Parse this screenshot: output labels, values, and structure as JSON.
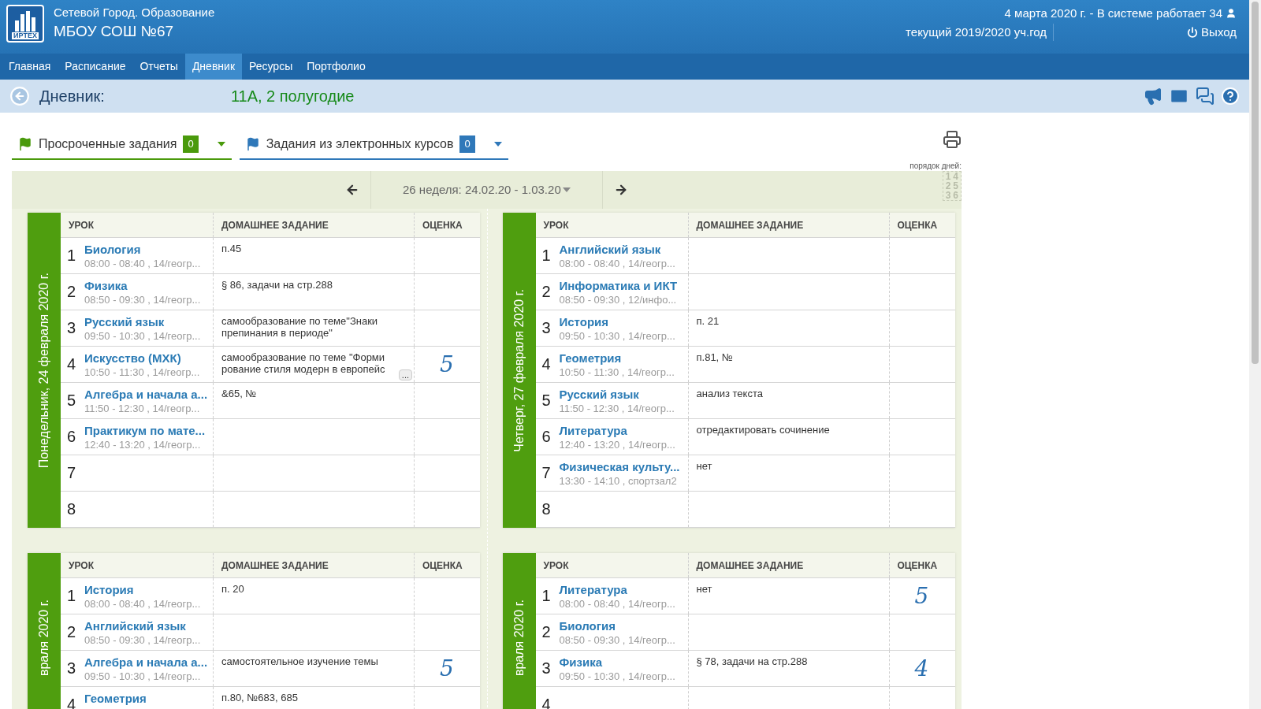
{
  "header": {
    "logo_text": "ИРТЕХ",
    "system": "Сетевой Город. Образование",
    "school": "МБОУ СОШ №67",
    "status": "4 марта 2020 г. - В системе работает 34",
    "year": "текущий 2019/2020 уч.год",
    "logout": "Выход"
  },
  "nav": [
    {
      "label": "Главная",
      "selected": false
    },
    {
      "label": "Расписание",
      "selected": false
    },
    {
      "label": "Отчеты",
      "selected": false
    },
    {
      "label": "Дневник",
      "selected": true
    },
    {
      "label": "Ресурсы",
      "selected": false
    },
    {
      "label": "Портфолио",
      "selected": false
    }
  ],
  "page_title": {
    "label": "Дневник:",
    "class_name": "11А, 2 полугодие"
  },
  "filters": [
    {
      "label": "Просроченные задания",
      "count": "0",
      "color": "#4a9a0c"
    },
    {
      "label": "Задания из электронных курсов",
      "count": "0",
      "color": "#2f78b9"
    }
  ],
  "day_order": {
    "label": "порядок дней:",
    "digits": [
      "1",
      "4",
      "2",
      "5",
      "3",
      "6"
    ]
  },
  "week": {
    "label": "26 неделя: 24.02.20 - 1.03.20"
  },
  "days": [
    {
      "title": "Понедельник, 24 февраля 2020 г.",
      "columns": [
        "УРОК",
        "ДОМАШНЕЕ ЗАДАНИЕ",
        "ОЦЕНКА"
      ],
      "lessons": [
        {
          "number": "1",
          "subject": "Биология",
          "time": "08:00 - 08:40 , 14/геогр...",
          "homework": "п.45"
        },
        {
          "number": "2",
          "subject": "Физика",
          "time": "08:50 - 09:30 , 14/геогр...",
          "homework": "§ 86, задачи на стр.288"
        },
        {
          "number": "3",
          "subject": "Русский язык",
          "time": "09:50 - 10:30 , 14/геогр...",
          "homework": "самообразование по теме\"Знаки препинания в периоде\""
        },
        {
          "number": "4",
          "subject": "Искусство (МХК)",
          "time": "10:50 - 11:30 , 14/геогр...",
          "homework": "самообразование по теме \"Форми рование стиля модерн в европейс",
          "more": "...",
          "grade": "5"
        },
        {
          "number": "5",
          "subject": "Алгебра и начала а...",
          "time": "11:50 - 12:30 , 14/геогр...",
          "homework": "&65, №"
        },
        {
          "number": "6",
          "subject": "Практикум по мате...",
          "time": "12:40 - 13:20 , 14/геогр..."
        },
        {
          "number": "7"
        },
        {
          "number": "8"
        }
      ]
    },
    {
      "title": "Четверг, 27 февраля 2020 г.",
      "columns": [
        "УРОК",
        "ДОМАШНЕЕ ЗАДАНИЕ",
        "ОЦЕНКА"
      ],
      "lessons": [
        {
          "number": "1",
          "subject": "Английский язык",
          "time": "08:00 - 08:40 , 14/геогр..."
        },
        {
          "number": "2",
          "subject": "Информатика и ИКТ",
          "time": "08:50 - 09:30 , 12/инфо..."
        },
        {
          "number": "3",
          "subject": "История",
          "time": "09:50 - 10:30 , 14/геогр...",
          "homework": "п. 21"
        },
        {
          "number": "4",
          "subject": "Геометрия",
          "time": "10:50 - 11:30 , 14/геогр...",
          "homework": "п.81, №"
        },
        {
          "number": "5",
          "subject": "Русский язык",
          "time": "11:50 - 12:30 , 14/геогр...",
          "homework": "анализ текста"
        },
        {
          "number": "6",
          "subject": "Литература",
          "time": "12:40 - 13:20 , 14/геогр...",
          "homework": "отредактировать сочинение"
        },
        {
          "number": "7",
          "subject": "Физическая культу...",
          "time": "13:30 - 14:10 , спортзал2",
          "homework": "нет"
        },
        {
          "number": "8"
        }
      ]
    },
    {
      "title": "враля 2020 г.",
      "columns": [
        "УРОК",
        "ДОМАШНЕЕ ЗАДАНИЕ",
        "ОЦЕНКА"
      ],
      "lessons": [
        {
          "number": "1",
          "subject": "История",
          "time": "08:00 - 08:40 , 14/геогр...",
          "homework": "п. 20"
        },
        {
          "number": "2",
          "subject": "Английский язык",
          "time": "08:50 - 09:30 , 14/геогр..."
        },
        {
          "number": "3",
          "subject": "Алгебра и начала а...",
          "time": "09:50 - 10:30 , 14/геогр...",
          "homework": "самостоятельное изучение темы",
          "grade": "5"
        },
        {
          "number": "4",
          "subject": "Геометрия",
          "homework": "п.80, №683, 685"
        }
      ]
    },
    {
      "title": "враля 2020 г.",
      "columns": [
        "УРОК",
        "ДОМАШНЕЕ ЗАДАНИЕ",
        "ОЦЕНКА"
      ],
      "lessons": [
        {
          "number": "1",
          "subject": "Литература",
          "time": "08:00 - 08:40 , 14/геогр...",
          "homework": "нет",
          "grade": "5"
        },
        {
          "number": "2",
          "subject": "Биология",
          "time": "08:50 - 09:30 , 14/геогр..."
        },
        {
          "number": "3",
          "subject": "Физика",
          "time": "09:50 - 10:30 , 14/геогр...",
          "homework": "§ 78, задачи на стр.288",
          "grade": "4"
        },
        {
          "number": "4"
        }
      ]
    }
  ]
}
